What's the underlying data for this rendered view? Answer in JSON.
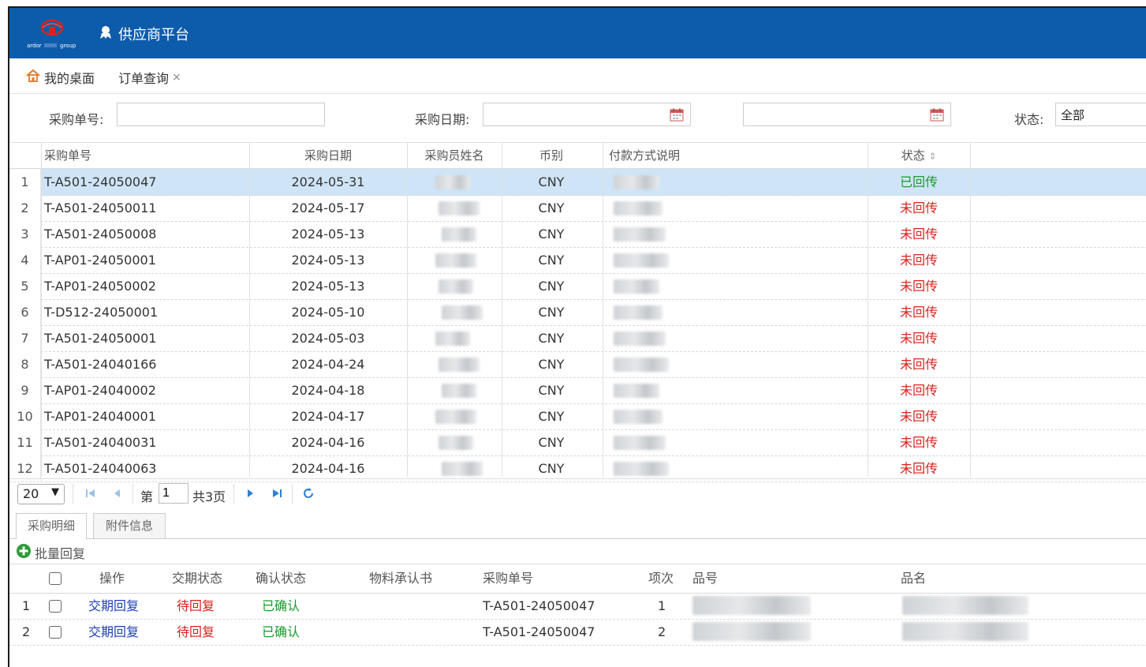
{
  "app": {
    "title": "供应商平台",
    "logo_text": "ardor group"
  },
  "tabs": {
    "home": "我的桌面",
    "order": "订单查询",
    "close": "×"
  },
  "filters": {
    "po_label": "采购单号:",
    "po_value": "",
    "date_label": "采购日期:",
    "date_from": "",
    "date_to": "",
    "status_label": "状态:",
    "status_value": "全部"
  },
  "grid": {
    "columns": [
      "采购单号",
      "采购日期",
      "采购员姓名",
      "币别",
      "付款方式说明",
      "状态"
    ],
    "sort_icon": "⇕",
    "rows": [
      {
        "no": "1",
        "po": "T-A501-24050047",
        "date": "2024-05-31",
        "currency": "CNY",
        "status": "已回传",
        "ok": true
      },
      {
        "no": "2",
        "po": "T-A501-24050011",
        "date": "2024-05-17",
        "currency": "CNY",
        "status": "未回传",
        "ok": false
      },
      {
        "no": "3",
        "po": "T-A501-24050008",
        "date": "2024-05-13",
        "currency": "CNY",
        "status": "未回传",
        "ok": false
      },
      {
        "no": "4",
        "po": "T-AP01-24050001",
        "date": "2024-05-13",
        "currency": "CNY",
        "status": "未回传",
        "ok": false
      },
      {
        "no": "5",
        "po": "T-AP01-24050002",
        "date": "2024-05-13",
        "currency": "CNY",
        "status": "未回传",
        "ok": false
      },
      {
        "no": "6",
        "po": "T-D512-24050001",
        "date": "2024-05-10",
        "currency": "CNY",
        "status": "未回传",
        "ok": false
      },
      {
        "no": "7",
        "po": "T-A501-24050001",
        "date": "2024-05-03",
        "currency": "CNY",
        "status": "未回传",
        "ok": false
      },
      {
        "no": "8",
        "po": "T-A501-24040166",
        "date": "2024-04-24",
        "currency": "CNY",
        "status": "未回传",
        "ok": false
      },
      {
        "no": "9",
        "po": "T-AP01-24040002",
        "date": "2024-04-18",
        "currency": "CNY",
        "status": "未回传",
        "ok": false
      },
      {
        "no": "10",
        "po": "T-AP01-24040001",
        "date": "2024-04-17",
        "currency": "CNY",
        "status": "未回传",
        "ok": false
      },
      {
        "no": "11",
        "po": "T-A501-24040031",
        "date": "2024-04-16",
        "currency": "CNY",
        "status": "未回传",
        "ok": false
      },
      {
        "no": "12",
        "po": "T-A501-24040063",
        "date": "2024-04-16",
        "currency": "CNY",
        "status": "未回传",
        "ok": false
      }
    ]
  },
  "pager": {
    "page_size": "20",
    "page_prefix": "第",
    "page": "1",
    "total": "共3页"
  },
  "subtabs": {
    "detail": "采购明细",
    "attach": "附件信息"
  },
  "batch": {
    "label": "批量回复"
  },
  "detail": {
    "columns": [
      "操作",
      "交期状态",
      "确认状态",
      "物料承认书",
      "采购单号",
      "项次",
      "品号",
      "品名"
    ],
    "rows": [
      {
        "no": "1",
        "action": "交期回复",
        "delivery": "待回复",
        "confirm": "已确认",
        "po": "T-A501-24050047",
        "item": "1"
      },
      {
        "no": "2",
        "action": "交期回复",
        "delivery": "待回复",
        "confirm": "已确认",
        "po": "T-A501-24050047",
        "item": "2"
      }
    ]
  },
  "colors": {
    "header": "#0d5cab",
    "selected_row": "#cfe5f7",
    "ok": "#1a9a2b",
    "pending": "#d9221c",
    "link": "#1d3fb8"
  }
}
